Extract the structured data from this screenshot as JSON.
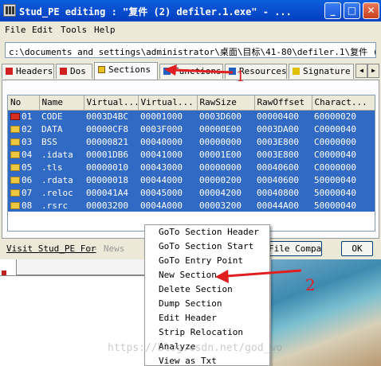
{
  "window": {
    "title": "Stud_PE editing : \"复件 (2) defiler.1.exe\" - ...",
    "buttons": {
      "minimize": "_",
      "maximize": "□",
      "close": "✕"
    }
  },
  "menu": [
    "File",
    "Edit",
    "Tools",
    "Help"
  ],
  "path": "c:\\documents and settings\\administrator\\桌面\\目标\\41-80\\defiler.1\\复件 (2) de",
  "tabs": [
    {
      "label": "Headers",
      "icon_color": "#d02020"
    },
    {
      "label": "Dos",
      "icon_color": "#d02020"
    },
    {
      "label": "Sections",
      "icon_color": "#e8c020",
      "active": true
    },
    {
      "label": "Functions",
      "icon_color": "#2060c0"
    },
    {
      "label": "Resources",
      "icon_color": "#2060c0"
    },
    {
      "label": "Signature",
      "icon_color": "#e0c000"
    }
  ],
  "table": {
    "columns": [
      "No",
      "Name",
      "Virtual...",
      "Virtual...",
      "RawSize",
      "RawOffset",
      "Charact..."
    ],
    "rows": [
      {
        "no": "01",
        "name": "CODE",
        "vsize": "0003D4BC",
        "vaddr": "00001000",
        "rawsize": "0003D600",
        "rawoffset": "00000400",
        "charact": "60000020",
        "icon": "ep"
      },
      {
        "no": "02",
        "name": "DATA",
        "vsize": "00000CF8",
        "vaddr": "0003F000",
        "rawsize": "00000E00",
        "rawoffset": "0003DA00",
        "charact": "C0000040",
        "icon": "folder"
      },
      {
        "no": "03",
        "name": "BSS",
        "vsize": "00000821",
        "vaddr": "00040000",
        "rawsize": "00000000",
        "rawoffset": "0003E800",
        "charact": "C0000000",
        "icon": "folder"
      },
      {
        "no": "04",
        "name": ".idata",
        "vsize": "00001DB6",
        "vaddr": "00041000",
        "rawsize": "00001E00",
        "rawoffset": "0003E800",
        "charact": "C0000040",
        "icon": "folder"
      },
      {
        "no": "05",
        "name": ".tls",
        "vsize": "00000010",
        "vaddr": "00043000",
        "rawsize": "00000000",
        "rawoffset": "00040600",
        "charact": "C0000000",
        "icon": "folder"
      },
      {
        "no": "06",
        "name": ".rdata",
        "vsize": "00000018",
        "vaddr": "00044000",
        "rawsize": "00000200",
        "rawoffset": "00040600",
        "charact": "50000040",
        "icon": "folder"
      },
      {
        "no": "07",
        "name": ".reloc",
        "vsize": "000041A4",
        "vaddr": "00045000",
        "rawsize": "00004200",
        "rawoffset": "00040800",
        "charact": "50000040",
        "icon": "folder"
      },
      {
        "no": "08",
        "name": ".rsrc",
        "vsize": "00003200",
        "vaddr": "0004A000",
        "rawsize": "00003200",
        "rawoffset": "00044A00",
        "charact": "50000040",
        "icon": "folder"
      }
    ]
  },
  "bottom": {
    "visit_link": "Visit Stud_PE For",
    "news": "<- News",
    "file_compare": "File Compare",
    "ok": "OK"
  },
  "context_menu": [
    "GoTo Section Header",
    "GoTo Section Start",
    "GoTo Entry Point",
    "New Section",
    "Delete Section",
    "Dump Section",
    "Edit Header",
    "Strip Relocation",
    "Analyze",
    "View as Txt"
  ],
  "annotations": {
    "label1": "1",
    "label2": "2",
    "color": "#e02020"
  },
  "watermark": "https://blog.csdn.net/god_wo"
}
